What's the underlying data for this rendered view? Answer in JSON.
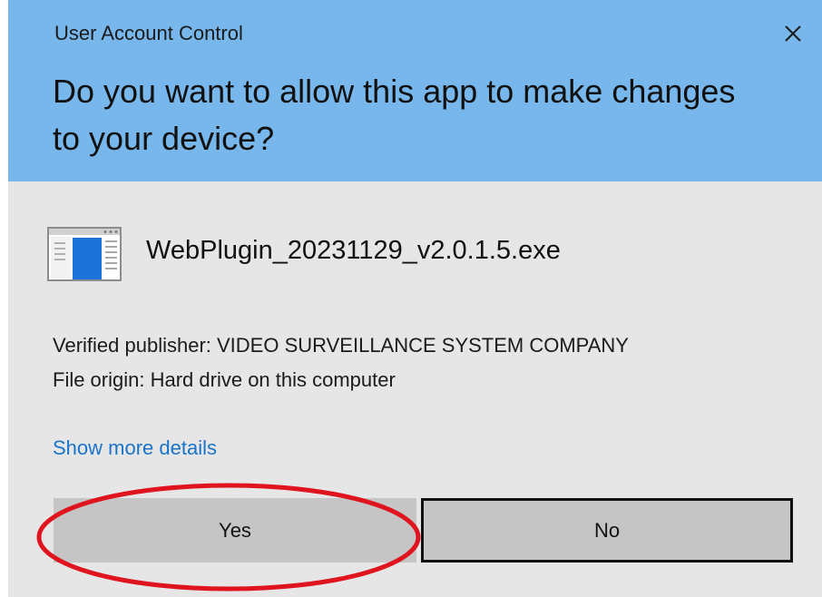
{
  "dialog": {
    "title": "User Account Control",
    "question": "Do you want to allow this app to make changes to your device?",
    "app_name": "WebPlugin_20231129_v2.0.1.5.exe",
    "publisher_line": "Verified publisher: VIDEO SURVEILLANCE SYSTEM COMPANY",
    "origin_line": "File origin: Hard drive on this computer",
    "details_link": "Show more details",
    "yes_label": "Yes",
    "no_label": "No"
  },
  "icons": {
    "close": "close-icon",
    "app": "application-window-icon"
  },
  "colors": {
    "header": "#77b7eb",
    "body": "#e6e6e6",
    "link": "#1a74c9",
    "button": "#c5c5c5",
    "highlight": "#e0141e"
  }
}
